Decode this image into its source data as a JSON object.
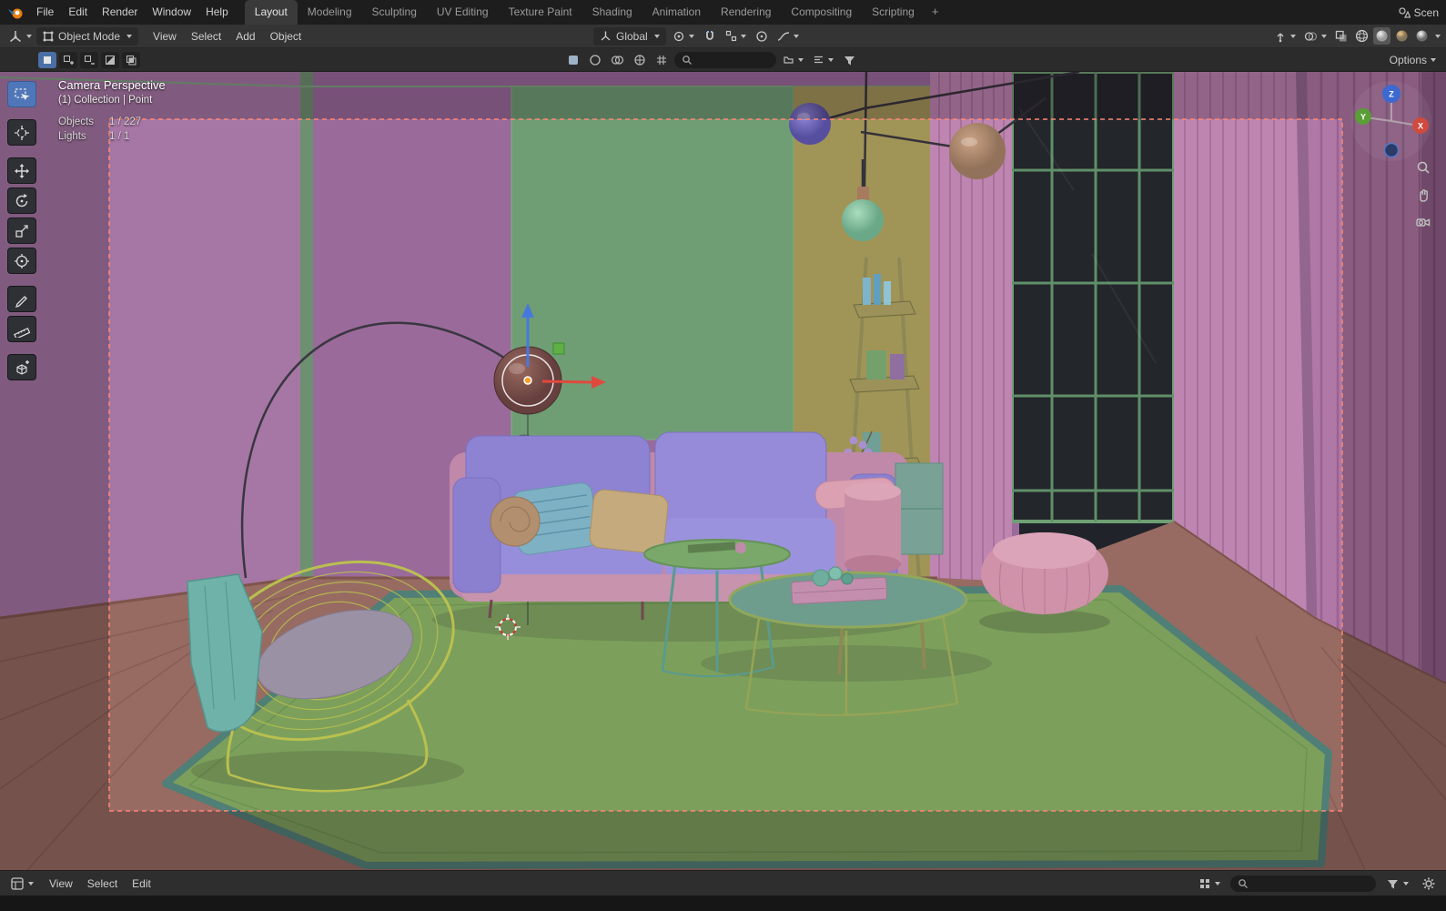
{
  "topbar": {
    "menus": [
      "File",
      "Edit",
      "Render",
      "Window",
      "Help"
    ],
    "tabs": [
      {
        "label": "Layout"
      },
      {
        "label": "Modeling"
      },
      {
        "label": "Sculpting"
      },
      {
        "label": "UV Editing"
      },
      {
        "label": "Texture Paint"
      },
      {
        "label": "Shading"
      },
      {
        "label": "Animation"
      },
      {
        "label": "Rendering"
      },
      {
        "label": "Compositing"
      },
      {
        "label": "Scripting"
      }
    ],
    "add_tab_label": "+",
    "scene_label": "Scen"
  },
  "viewport_header": {
    "mode_label": "Object Mode",
    "menus": [
      "View",
      "Select",
      "Add",
      "Object"
    ],
    "orientation_label": "Global"
  },
  "tool_settings": {
    "options_label": "Options",
    "search_value": ""
  },
  "viewport_overlay": {
    "view_label": "Camera Perspective",
    "context_label": "(1) Collection | Point",
    "stats": [
      {
        "label": "Objects",
        "value": "1 / 227"
      },
      {
        "label": "Lights",
        "value": "1 / 1"
      }
    ]
  },
  "nav_gizmo": {
    "axes": [
      "X",
      "Y",
      "Z"
    ]
  },
  "bottom_bar": {
    "menus": [
      "View",
      "Select",
      "Edit"
    ],
    "search_value": ""
  },
  "colors": {
    "accent_blue": "#4f76b8",
    "topbar_bg": "#1d1d1d",
    "header_bg": "#343434",
    "wall_purple": "#9a6a9b",
    "wall_green_panel": "#6f9e74",
    "floor_brown": "#976b62",
    "rug_green": "#7ca05b",
    "sofa_purple": "#8d83d2",
    "sofa_pink": "#c089a9",
    "pouf_pink": "#cf92a8",
    "camera_border": "#ff8576",
    "gizmo_red": "#e0493e",
    "gizmo_blue": "#4878dc",
    "gizmo_green": "#5fae46"
  }
}
